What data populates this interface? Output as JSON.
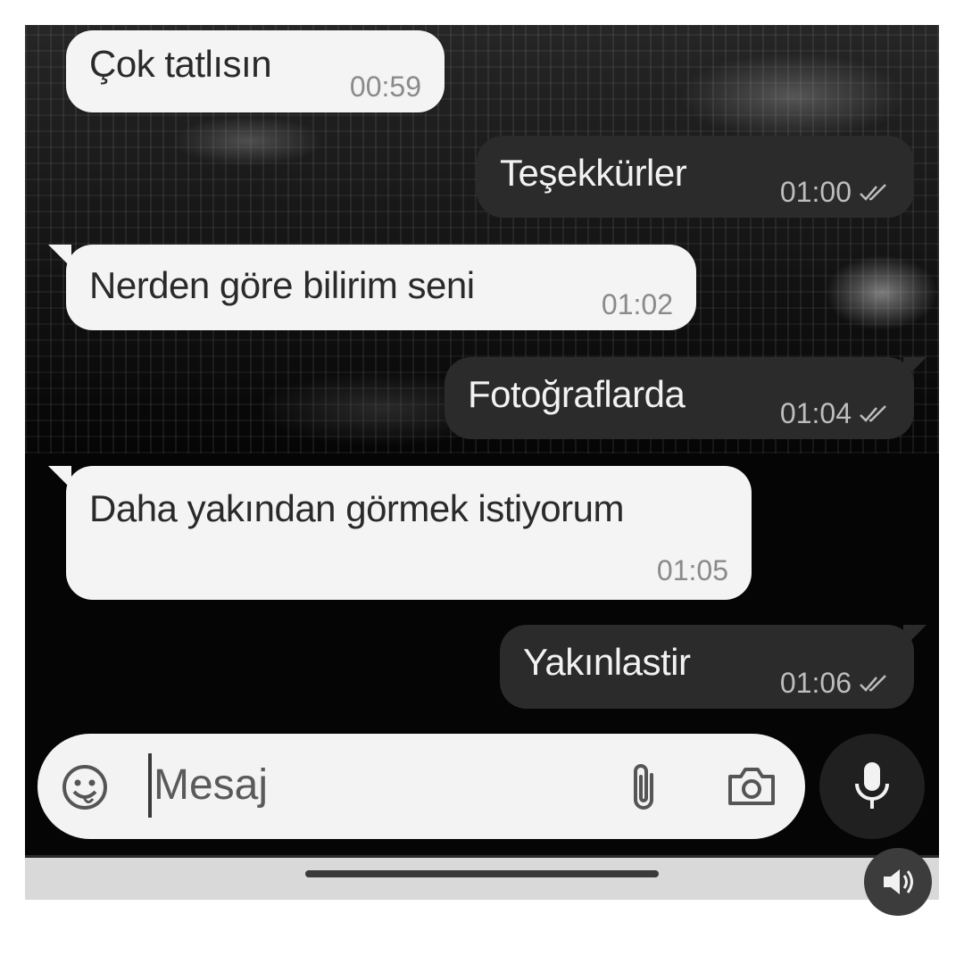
{
  "messages": [
    {
      "direction": "incoming",
      "text": "Çok tatlısın",
      "time": "00:59"
    },
    {
      "direction": "outgoing",
      "text": "Teşekkürler",
      "time": "01:00",
      "status": "read-double-check"
    },
    {
      "direction": "incoming",
      "text": "Nerden göre bilirim seni",
      "time": "01:02"
    },
    {
      "direction": "outgoing",
      "text": "Fotoğraflarda",
      "time": "01:04",
      "status": "read-double-check"
    },
    {
      "direction": "incoming",
      "text": "Daha yakından görmek istiyorum",
      "time": "01:05"
    },
    {
      "direction": "outgoing",
      "text": "Yakınlastir",
      "time": "01:06",
      "status": "read-double-check"
    }
  ],
  "composer": {
    "placeholder": "Mesaj",
    "icons": [
      "emoji-icon",
      "paperclip-icon",
      "camera-icon",
      "microphone-icon"
    ]
  },
  "overlay": {
    "icons": [
      "speaker-icon"
    ]
  },
  "colors": {
    "incoming_bubble": "#f4f4f4",
    "outgoing_bubble": "#2b2b2b",
    "background": "#050505"
  }
}
